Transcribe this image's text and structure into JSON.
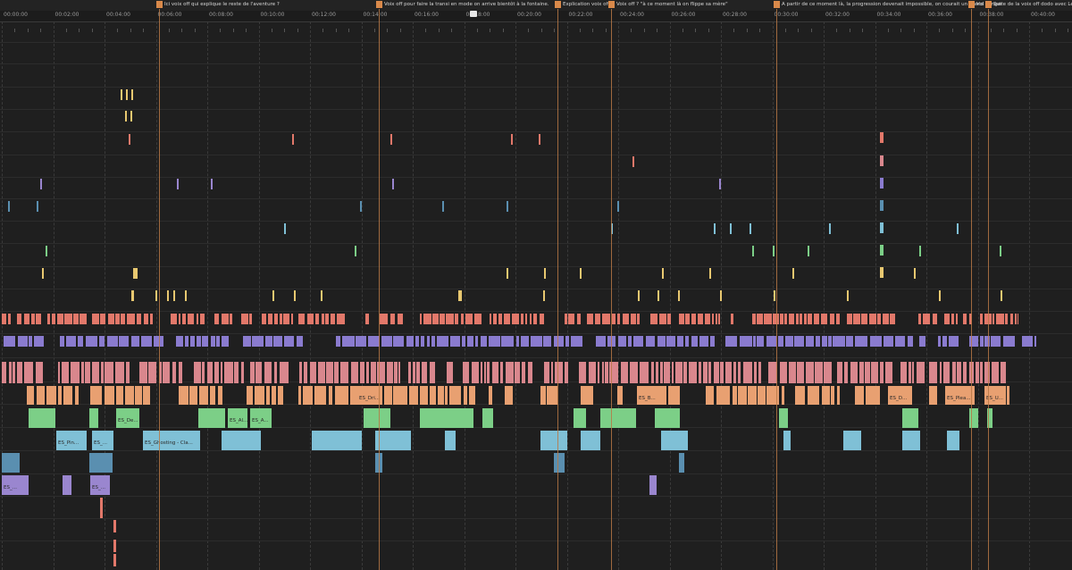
{
  "app": "video editor timeline",
  "ruler": {
    "ticks": [
      "00:00:00",
      "00:02:00",
      "00:04:00",
      "00:06:00",
      "00:08:00",
      "00:10:00",
      "00:12:00",
      "00:14:00",
      "00:16:00",
      "00:18:00",
      "00:20:00",
      "00:22:00",
      "00:24:00",
      "00:26:00",
      "00:28:00",
      "00:30:00",
      "00:32:00",
      "00:34:00",
      "00:36:00",
      "00:38:00",
      "00:40:00"
    ]
  },
  "playhead": {
    "time_label": "00:18:00"
  },
  "markers": [
    {
      "flag": "",
      "text": "Ici voix off qui explique le reste de l'aventure ?"
    },
    {
      "flag": "",
      "text": "Voix off pour faire la transi en mode on arrive bientôt à la fontaine."
    },
    {
      "flag": "",
      "text": "Explication voix off +"
    },
    {
      "flag": "",
      "text": "Voix off ? \"à ce moment là on flippe sa mère\""
    },
    {
      "flag": "",
      "text": "A partir de ce moment là, la progression devenait impossible, on courait un grand danger"
    },
    {
      "flag": "",
      "text": "Voi"
    },
    {
      "flag": "",
      "text": "Suite de la voix off dodo avec Léo qui"
    }
  ],
  "clip_labels": [
    "ES_Dri...",
    "ES_B...",
    "ES_D...",
    "ES_Plea...",
    "ES_U...",
    "ES_De...",
    "ES_Al...",
    "ES_A...",
    "ES_Pin...",
    "ES_...",
    "ES_Ghosting - Cla...",
    "ES_...",
    "ES_..."
  ],
  "colors": {
    "background": "#1f1f1f",
    "marker": "#d9894a",
    "track_salmon": "#e2786a",
    "track_purple": "#8a7bcf",
    "track_pink": "#d9878d",
    "track_orange": "#e8a071",
    "track_green": "#7ccf87",
    "track_cyan": "#7fc0d6",
    "track_steel": "#5a8fb0",
    "track_yellow": "#e8c870",
    "track_lavender": "#9a86cf"
  }
}
